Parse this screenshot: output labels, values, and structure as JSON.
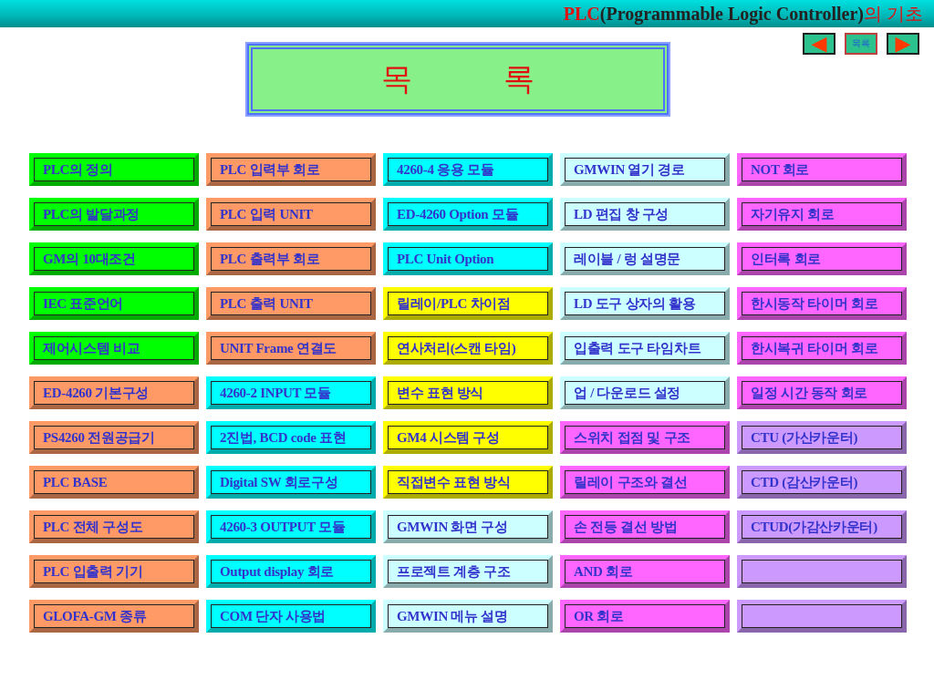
{
  "header": {
    "title_parts": [
      {
        "text": "PLC",
        "kind": "accent"
      },
      {
        "text": "(Programmable Logic Controller)",
        "kind": "plain"
      },
      {
        "text": "의 기초",
        "kind": "accent"
      }
    ]
  },
  "nav": {
    "prev": "◀",
    "home": "목록",
    "next": "▶"
  },
  "heading": "목 록",
  "columns": [
    {
      "items": [
        {
          "label": "PLC의 정의",
          "color": "#00ff00"
        },
        {
          "label": "PLC의 발달과정",
          "color": "#00ff00"
        },
        {
          "label": "GM의 10대조건",
          "color": "#00ff00"
        },
        {
          "label": "IEC 표준언어",
          "color": "#00ff00"
        },
        {
          "label": "제어시스템 비교",
          "color": "#00ff00"
        },
        {
          "label": "ED-4260 기본구성",
          "color": "#ff9966"
        },
        {
          "label": "PS4260 전원공급기",
          "color": "#ff9966"
        },
        {
          "label": "PLC BASE",
          "color": "#ff9966"
        },
        {
          "label": "PLC 전체 구성도",
          "color": "#ff9966"
        },
        {
          "label": "PLC 입출력 기기",
          "color": "#ff9966"
        },
        {
          "label": "GLOFA-GM 종류",
          "color": "#ff9966"
        }
      ]
    },
    {
      "items": [
        {
          "label": "PLC 입력부 회로",
          "color": "#ff9966"
        },
        {
          "label": "PLC 입력 UNIT",
          "color": "#ff9966"
        },
        {
          "label": "PLC 출력부 회로",
          "color": "#ff9966"
        },
        {
          "label": "PLC 출력 UNIT",
          "color": "#ff9966"
        },
        {
          "label": "UNIT Frame 연결도",
          "color": "#ff9966"
        },
        {
          "label": "4260-2 INPUT 모듈",
          "color": "#00ffff"
        },
        {
          "label": "2진법, BCD code 표현",
          "color": "#00ffff"
        },
        {
          "label": "Digital SW 회로구성",
          "color": "#00ffff"
        },
        {
          "label": "4260-3 OUTPUT 모듈",
          "color": "#00ffff"
        },
        {
          "label": "Output display 회로",
          "color": "#00ffff"
        },
        {
          "label": "COM 단자 사용법",
          "color": "#00ffff"
        }
      ]
    },
    {
      "items": [
        {
          "label": "4260-4 응용 모듈",
          "color": "#00ffff"
        },
        {
          "label": "ED-4260 Option 모듈",
          "color": "#00ffff"
        },
        {
          "label": "PLC Unit Option",
          "color": "#00ffff"
        },
        {
          "label": "릴레이/PLC 차이점",
          "color": "#ffff00"
        },
        {
          "label": "연사처리(스캔 타임)",
          "color": "#ffff00"
        },
        {
          "label": "변수 표현 방식",
          "color": "#ffff00"
        },
        {
          "label": "GM4 시스템 구성",
          "color": "#ffff00"
        },
        {
          "label": "직접변수 표현 방식",
          "color": "#ffff00"
        },
        {
          "label": "GMWIN 화면 구성",
          "color": "#ccffff"
        },
        {
          "label": "프로젝트 계층 구조",
          "color": "#ccffff"
        },
        {
          "label": "GMWIN 메뉴 설명",
          "color": "#ccffff"
        }
      ]
    },
    {
      "items": [
        {
          "label": "GMWIN 열기 경로",
          "color": "#ccffff"
        },
        {
          "label": "LD 편집 창 구성",
          "color": "#ccffff"
        },
        {
          "label": "레이블 / 렁 설명문",
          "color": "#ccffff"
        },
        {
          "label": "LD 도구 상자의 활용",
          "color": "#ccffff"
        },
        {
          "label": "입출력 도구 타임차트",
          "color": "#ccffff"
        },
        {
          "label": "업 / 다운로드 설정",
          "color": "#ccffff"
        },
        {
          "label": "스위치 접점 및 구조",
          "color": "#ff66ff"
        },
        {
          "label": "릴레이 구조와 결선",
          "color": "#ff66ff"
        },
        {
          "label": "손 전등 결선 방법",
          "color": "#ff66ff"
        },
        {
          "label": "AND 회로",
          "color": "#ff66ff"
        },
        {
          "label": "OR 회로",
          "color": "#ff66ff"
        }
      ]
    },
    {
      "items": [
        {
          "label": "NOT 회로",
          "color": "#ff66ff"
        },
        {
          "label": "자기유지 회로",
          "color": "#ff66ff"
        },
        {
          "label": "인터록 회로",
          "color": "#ff66ff"
        },
        {
          "label": "한시동작 타이머 회로",
          "color": "#ff66ff"
        },
        {
          "label": "한시복귀 타이머 회로",
          "color": "#ff66ff"
        },
        {
          "label": "일정 시간 동작 회로",
          "color": "#ff66ff"
        },
        {
          "label": "CTU (가산카운터)",
          "color": "#cc99ff"
        },
        {
          "label": "CTD (감산카운터)",
          "color": "#cc99ff"
        },
        {
          "label": "CTUD(가감산카운터)",
          "color": "#cc99ff"
        },
        {
          "color": "#cc99ff"
        },
        {
          "color": "#cc99ff"
        }
      ]
    }
  ]
}
